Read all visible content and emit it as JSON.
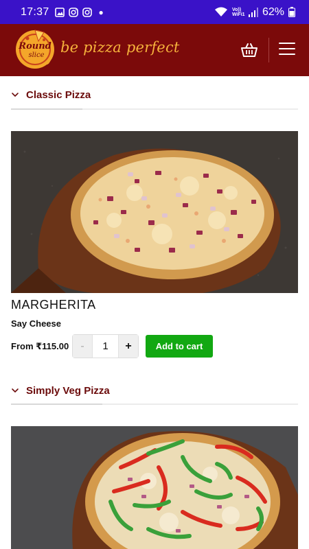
{
  "status_bar": {
    "time": "17:37",
    "network_label": "Vo)) WiFi1",
    "battery": "62%"
  },
  "header": {
    "logo_text": "Round slice",
    "tagline": "be pizza perfect",
    "colors": {
      "background": "#7b0a0a",
      "accent": "#f6b33c"
    }
  },
  "sections": [
    {
      "title": "Classic Pizza",
      "product": {
        "name": "MARGHERITA",
        "subtitle": "Say Cheese",
        "price_label": "From",
        "price": "₹115.00",
        "quantity": "1",
        "minus_label": "-",
        "plus_label": "+",
        "add_to_cart_label": "Add to cart"
      }
    },
    {
      "title": "Simply Veg Pizza"
    }
  ],
  "colors": {
    "add_to_cart": "#12a812",
    "section_title": "#6b0b0b"
  }
}
